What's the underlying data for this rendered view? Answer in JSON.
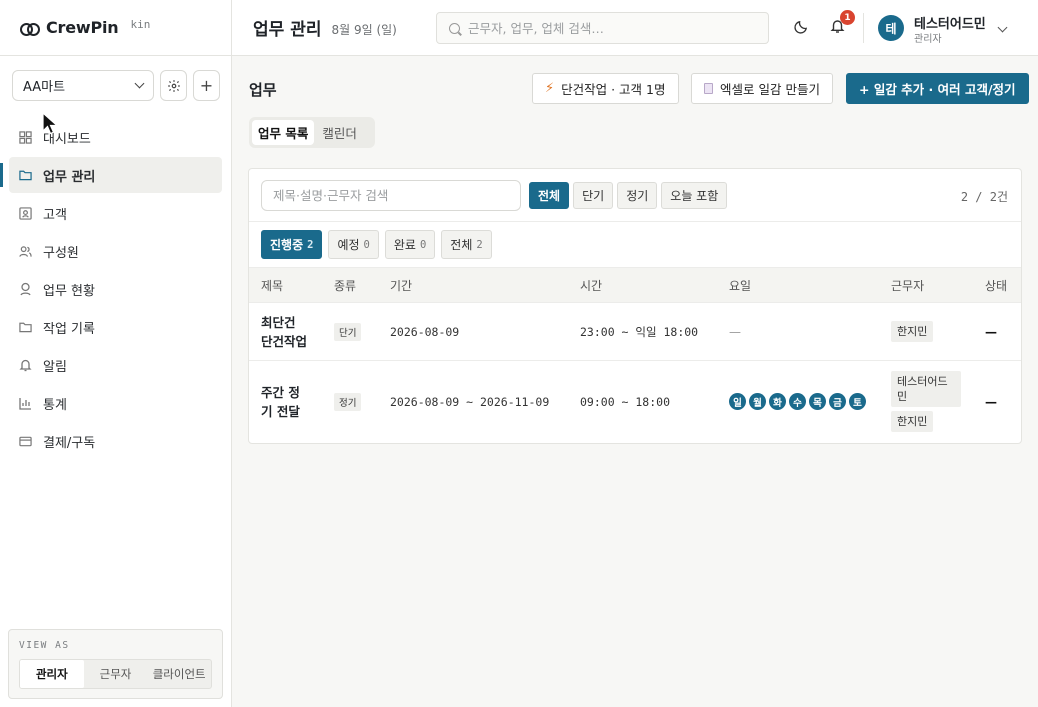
{
  "brand": {
    "name": "CrewPin",
    "version": "kin"
  },
  "store": {
    "selected": "AA마트",
    "add_label": "+"
  },
  "nav": [
    {
      "label": "대시보드",
      "icon": "grid-icon"
    },
    {
      "label": "업무 관리",
      "icon": "folder-icon",
      "active": true
    },
    {
      "label": "고객",
      "icon": "id-card-icon"
    },
    {
      "label": "구성원",
      "icon": "users-icon"
    },
    {
      "label": "업무 현황",
      "icon": "pin-icon"
    },
    {
      "label": "작업 기록",
      "icon": "folder-icon"
    },
    {
      "label": "알림",
      "icon": "bell-icon"
    },
    {
      "label": "통계",
      "icon": "chart-icon"
    },
    {
      "label": "결제/구독",
      "icon": "card-icon"
    }
  ],
  "viewas": {
    "label": "VIEW AS",
    "tabs": [
      "관리자",
      "근무자",
      "클라이언트"
    ],
    "active": 0
  },
  "topbar": {
    "title": "업무 관리",
    "date": "8월 9일 (일)",
    "search_placeholder": "근무자, 업무, 업체 검색…",
    "notif_count": "1",
    "user": {
      "initial": "테",
      "name": "테스터어드민",
      "role": "관리자"
    }
  },
  "main": {
    "section_title": "업무",
    "actions": {
      "single": "단건작업 · 고객 1명",
      "excel": "엑셀로 일감 만들기",
      "add": "+ 일감 추가 · 여러 고객/정기"
    },
    "view_tabs": [
      "업무 목록",
      "캘린더"
    ],
    "filter": {
      "placeholder": "제목·설명·근무자 검색",
      "chips": [
        "전체",
        "단기",
        "정기",
        "오늘 포함"
      ],
      "count": "2 / 2건"
    },
    "status_tabs": [
      {
        "label": "진행중",
        "n": "2"
      },
      {
        "label": "예정",
        "n": "0"
      },
      {
        "label": "완료",
        "n": "0"
      },
      {
        "label": "전체",
        "n": "2"
      }
    ],
    "columns": [
      "제목",
      "종류",
      "기간",
      "시간",
      "요일",
      "근무자",
      "상태"
    ],
    "rows": [
      {
        "title_line1": "최단건",
        "title_line2": "단건작업",
        "kind": "단기",
        "period": "2026-08-09",
        "time": "23:00 ~ 익일 18:00",
        "days": "—",
        "workers": [
          "한지민"
        ],
        "status": "—"
      },
      {
        "title_line1": "주간 정",
        "title_line2": "기 전달",
        "kind": "정기",
        "period": "2026-08-09 ~ 2026-11-09",
        "time": "09:00 ~ 18:00",
        "days": [
          "일",
          "월",
          "화",
          "수",
          "목",
          "금",
          "토"
        ],
        "workers": [
          "테스터어드민",
          "한지민"
        ],
        "status": "—"
      }
    ]
  }
}
